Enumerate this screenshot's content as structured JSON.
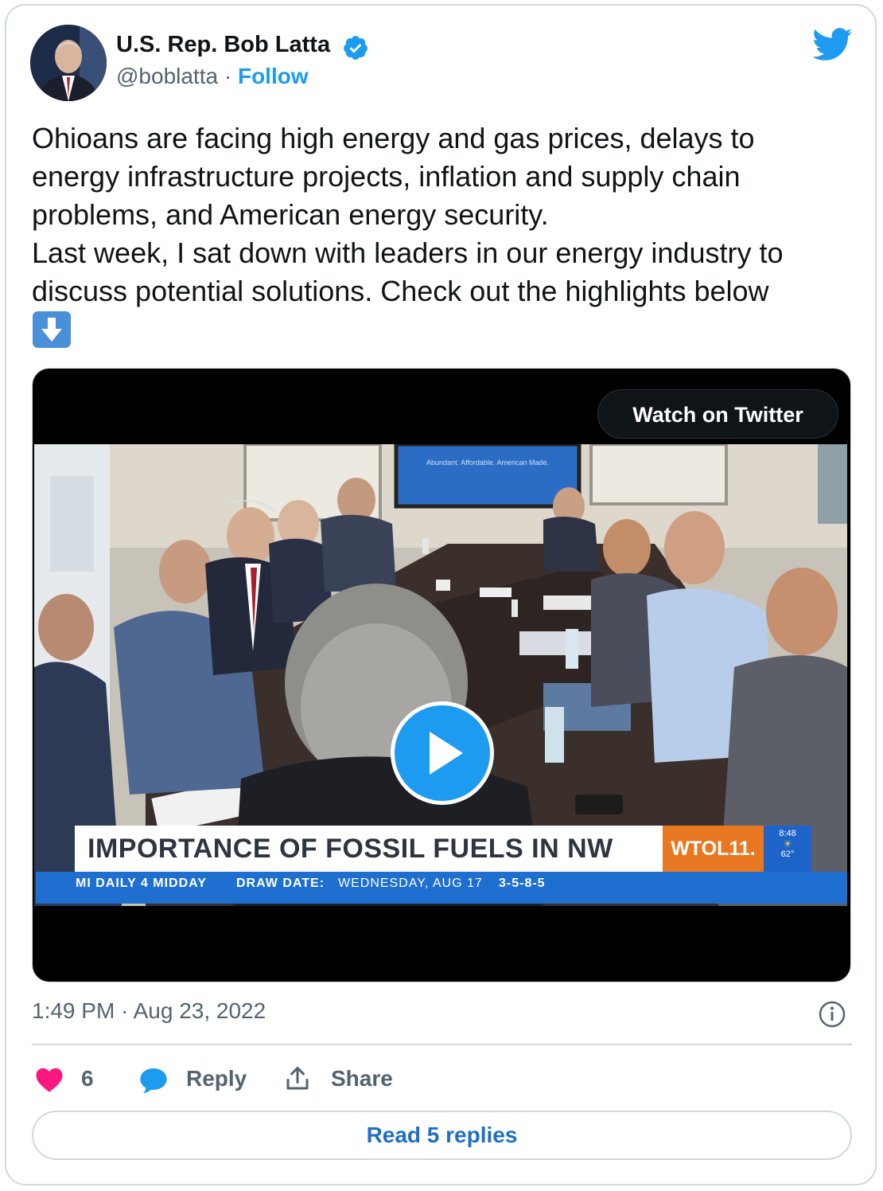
{
  "author": {
    "name": "U.S. Rep. Bob Latta",
    "handle": "@boblatta",
    "separator": "·",
    "follow_label": "Follow"
  },
  "tweet": {
    "text": "Ohioans are facing high energy and gas prices, delays to\nenergy infrastructure projects, inflation and supply chain\nproblems, and American energy security.\nLast week, I sat down with leaders in our energy industry to\ndiscuss potential solutions. Check out the highlights below",
    "emoji": "down-arrow-emoji"
  },
  "media": {
    "watch_label": "Watch on Twitter",
    "screen_slide": "Abundant. Affordable. American Made.",
    "lower_third": "IMPORTANCE OF FOSSIL FUELS IN NW OHIO",
    "station": "WTOL11.",
    "weather_time": "8:48",
    "weather_temp": "62°",
    "ticker": {
      "game": "MI DAILY 4 MIDDAY",
      "draw_label": "DRAW DATE:",
      "draw_date": "WEDNESDAY, AUG 17",
      "numbers": "3-5-8-5"
    }
  },
  "meta": {
    "timestamp": "1:49 PM · Aug 23, 2022"
  },
  "actions": {
    "likes": "6",
    "reply_label": "Reply",
    "share_label": "Share"
  },
  "read_replies_label": "Read 5 replies",
  "colors": {
    "brand": "#1d9bf0",
    "heart": "#f91880",
    "border": "#cfd9de",
    "muted": "#536471",
    "ticker": "#1f6fd1",
    "station": "#e87722"
  }
}
